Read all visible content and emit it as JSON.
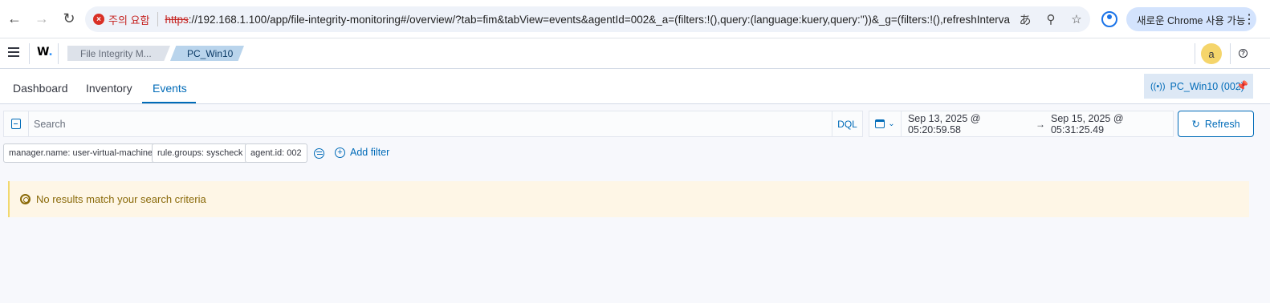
{
  "browser": {
    "security_label": "주의 요함",
    "url_scheme": "https",
    "url_rest": "://192.168.1.100/app/file-integrity-monitoring#/overview/?tab=fim&tabView=events&agentId=002&_a=(filters:!(),query:(language:kuery,query:''))&_g=(filters:!(),refreshInterval:(pause:!t,val...",
    "update_label": "새로운 Chrome 사용 가능",
    "icons": [
      "back-arrow-icon",
      "forward-arrow-icon",
      "reload-icon",
      "translate-icon",
      "zoom-icon",
      "star-icon",
      "profile-icon",
      "kebab-menu-icon"
    ]
  },
  "header": {
    "logo": "W",
    "breadcrumbs": [
      "File Integrity M...",
      "PC_Win10"
    ],
    "avatar_letter": "a"
  },
  "tabs": [
    {
      "label": "Dashboard"
    },
    {
      "label": "Inventory"
    },
    {
      "label": "Events",
      "active": true
    }
  ],
  "agent": {
    "label": "PC_Win10 (002)"
  },
  "search": {
    "placeholder": "Search",
    "language": "DQL"
  },
  "time_range": {
    "start": "Sep 13, 2025 @ 05:20:59.58",
    "arrow": "→",
    "end": "Sep 15, 2025 @ 05:31:25.49",
    "refresh_label": "Refresh"
  },
  "filters": [
    {
      "label": "manager.name: user-virtual-machine"
    },
    {
      "label": "rule.groups: syscheck"
    },
    {
      "label": "agent.id: 002"
    }
  ],
  "add_filter_label": "Add filter",
  "callout": {
    "message": "No results match your search criteria"
  },
  "colors": {
    "accent": "#006bb8",
    "warning_bg": "#fef6e6",
    "avatar_bg": "#f5d56b"
  }
}
